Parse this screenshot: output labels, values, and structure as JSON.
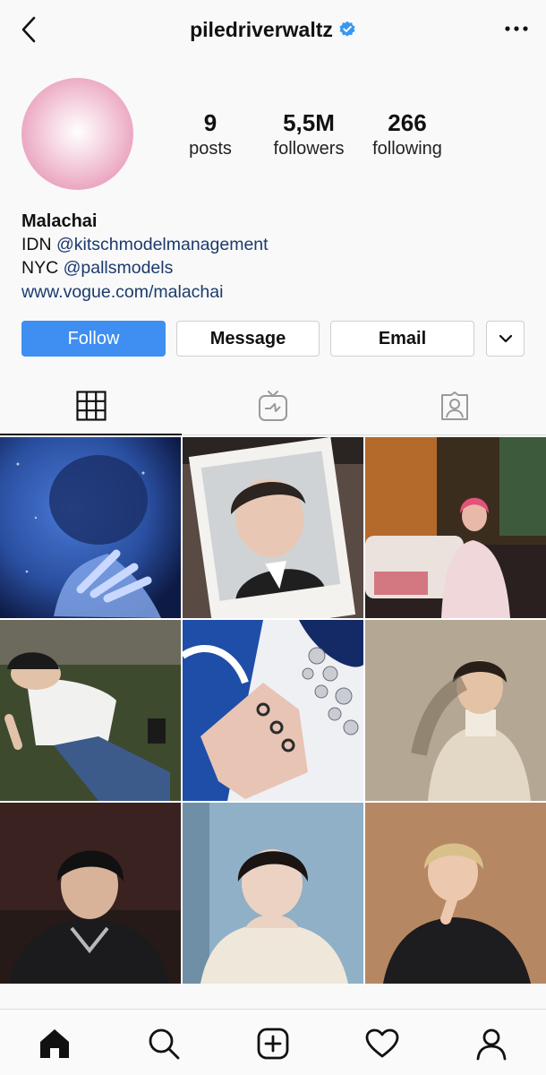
{
  "header": {
    "username": "piledriverwaltz",
    "back_icon": "chevron-left-icon",
    "verified_icon": "verified-badge-icon",
    "more_icon": "more-horizontal-icon"
  },
  "profile": {
    "stats": [
      {
        "value": "9",
        "label": "posts"
      },
      {
        "value": "5,5M",
        "label": "followers"
      },
      {
        "value": "266",
        "label": "following"
      }
    ],
    "name": "Malachai",
    "bio_lines": [
      {
        "prefix": "IDN ",
        "mention": "@kitschmodelmanagement"
      },
      {
        "prefix": "NYC ",
        "mention": "@pallsmodels"
      }
    ],
    "website": "www.vogue.com/malachai"
  },
  "actions": {
    "follow": "Follow",
    "message": "Message",
    "email": "Email",
    "more_icon": "chevron-down-icon"
  },
  "tabs": [
    {
      "icon": "grid-icon",
      "active": true
    },
    {
      "icon": "igtv-icon",
      "active": false
    },
    {
      "icon": "tagged-icon",
      "active": false
    }
  ],
  "posts": [
    {
      "subject": "blue glitter portrait with hand"
    },
    {
      "subject": "polaroid photos portrait"
    },
    {
      "subject": "pink hair street night"
    },
    {
      "subject": "lying on grass with cap"
    },
    {
      "subject": "hand with rings and crystal necklace"
    },
    {
      "subject": "smiling in turtleneck"
    },
    {
      "subject": "dark jacket with chain"
    },
    {
      "subject": "cream knit sweater portrait"
    },
    {
      "subject": "blond hair black suit"
    }
  ],
  "bottom_nav": [
    "home-icon",
    "search-icon",
    "new-post-icon",
    "activity-heart-icon",
    "profile-icon"
  ],
  "colors": {
    "accent": "#3f8ef2",
    "link": "#1b3a6d",
    "verified": "#3897f0"
  }
}
